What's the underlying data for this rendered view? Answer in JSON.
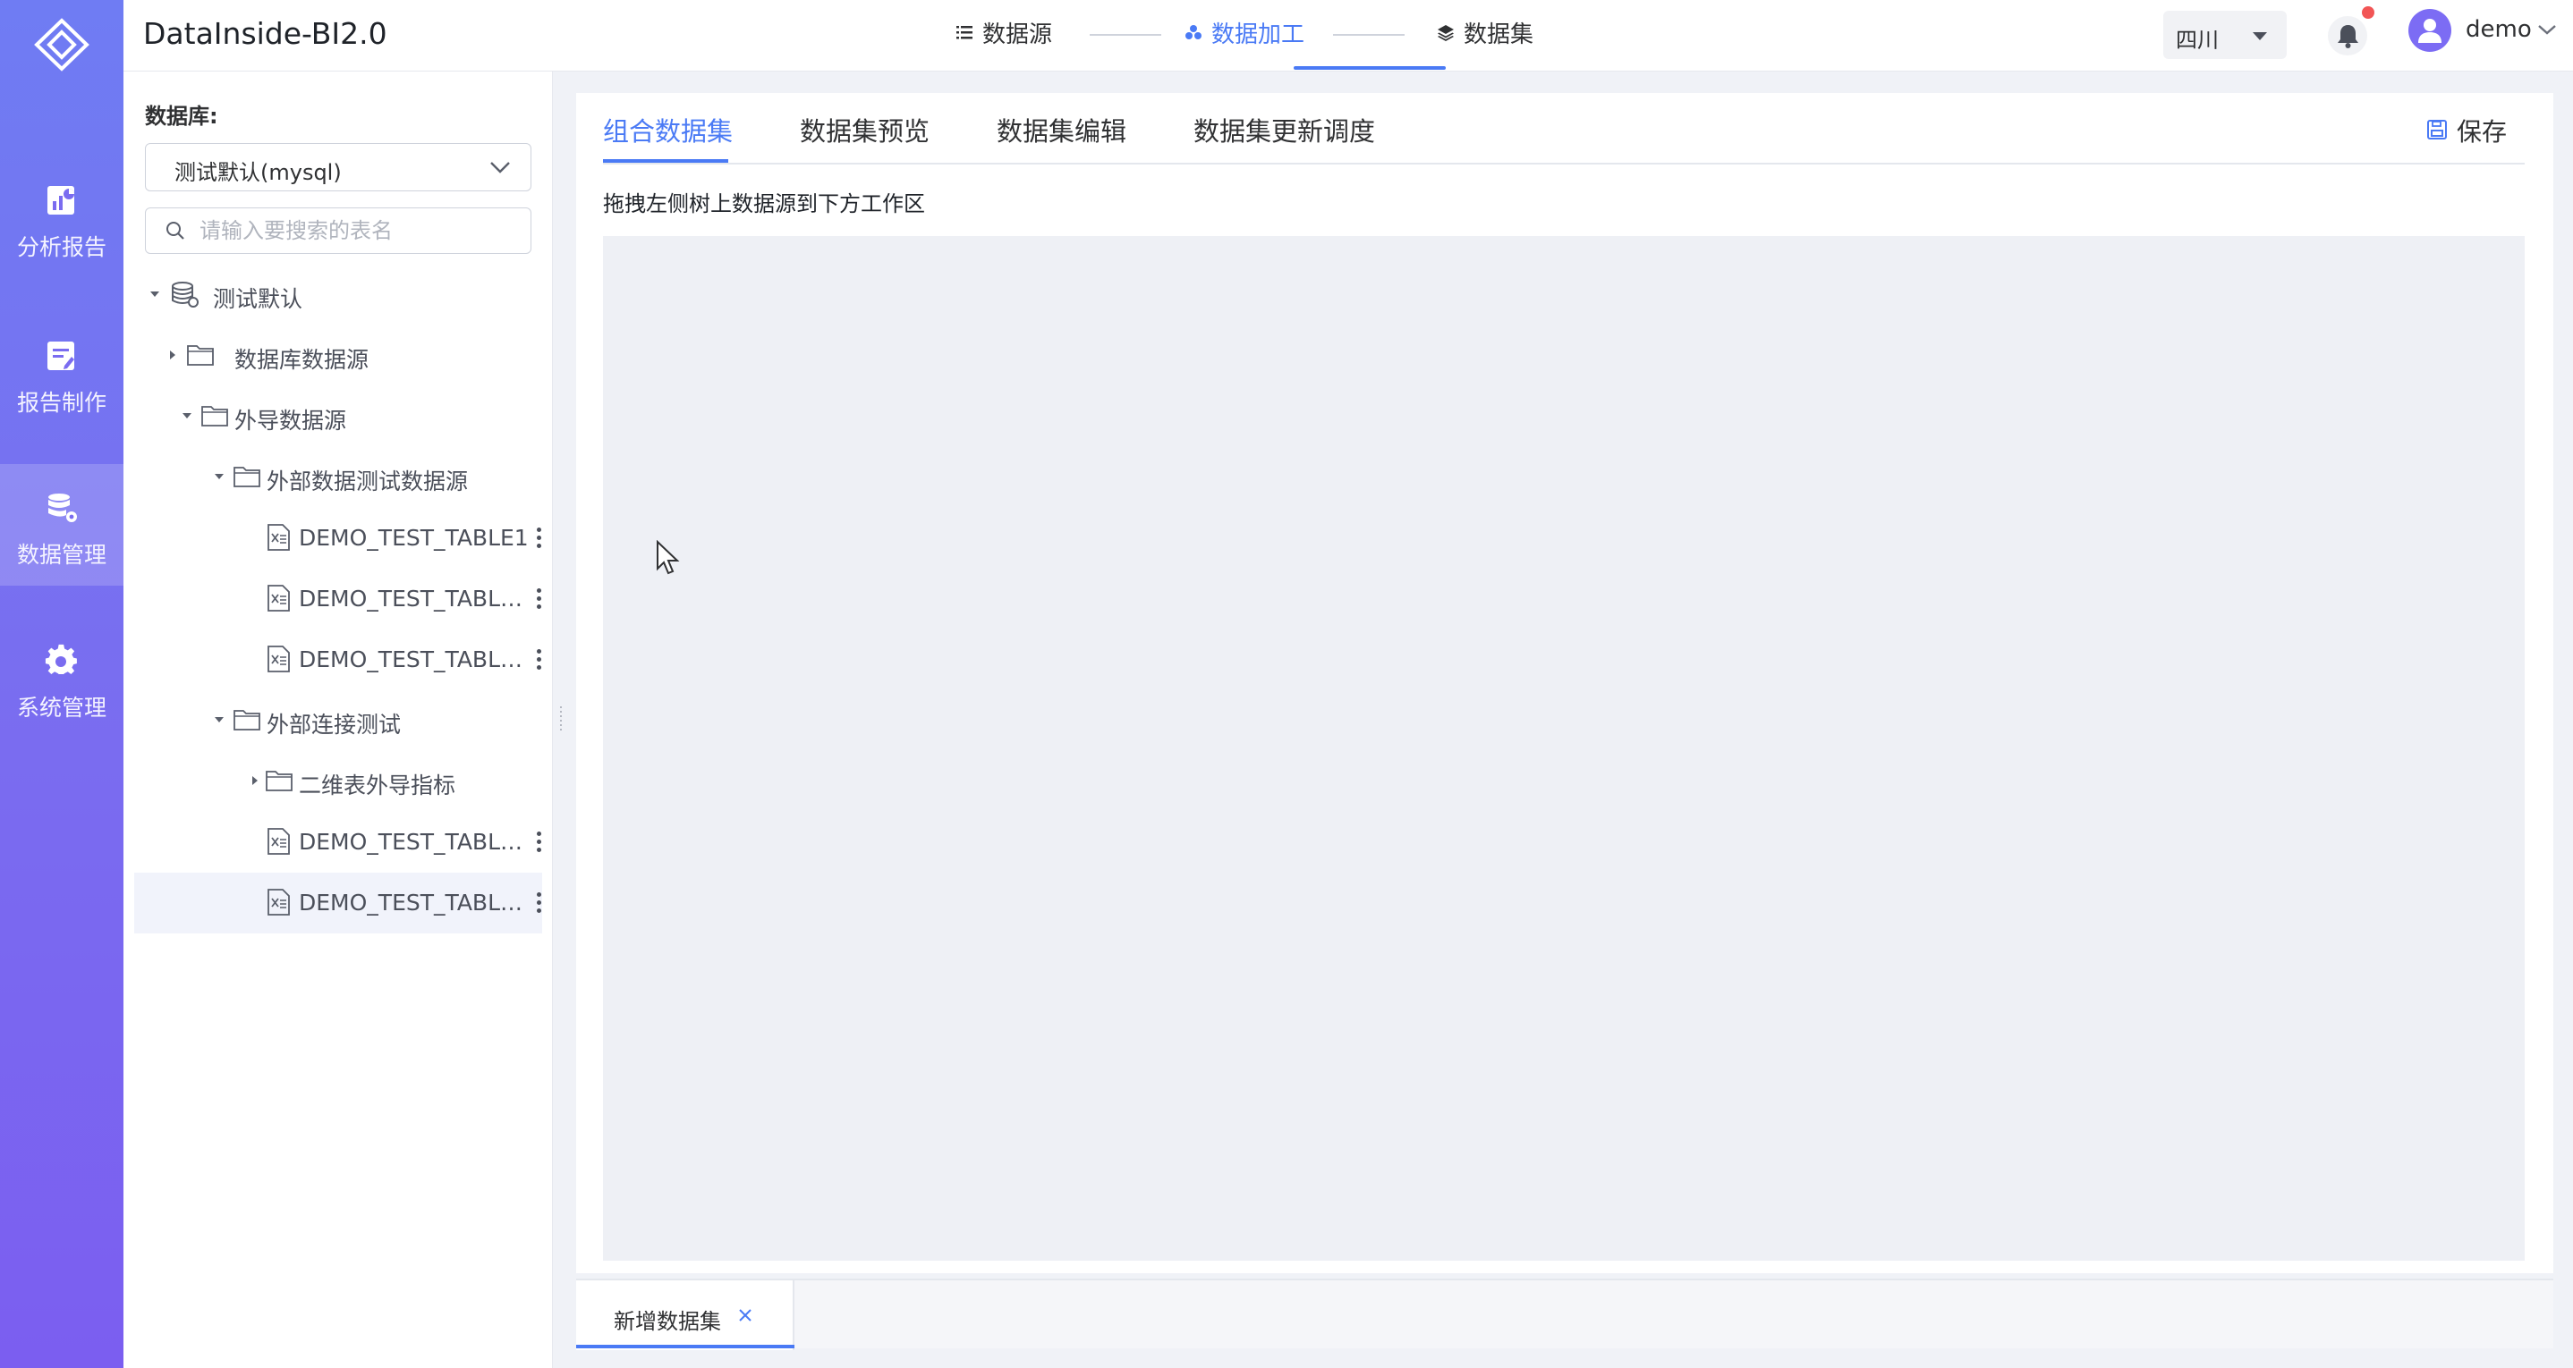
{
  "app": {
    "title": "DataInside-BI2.0"
  },
  "topnav": {
    "steps": [
      {
        "label": "数据源",
        "icon": "list-icon",
        "active": false
      },
      {
        "label": "数据加工",
        "icon": "cluster-icon",
        "active": true
      },
      {
        "label": "数据集",
        "icon": "layers-icon",
        "active": false
      }
    ],
    "region": "四川",
    "user": "demo"
  },
  "rail": {
    "items": [
      {
        "label": "分析报告",
        "icon": "analysis-report-icon",
        "active": false
      },
      {
        "label": "报告制作",
        "icon": "report-edit-icon",
        "active": false
      },
      {
        "label": "数据管理",
        "icon": "database-settings-icon",
        "active": true
      },
      {
        "label": "系统管理",
        "icon": "gear-icon",
        "active": false
      }
    ]
  },
  "leftpanel": {
    "db_label": "数据库:",
    "db_value": "测试默认(mysql)",
    "search_placeholder": "请输入要搜索的表名",
    "tree": [
      {
        "label": "测试默认",
        "type": "database",
        "level": 0,
        "expanded": true
      },
      {
        "label": "数据库数据源",
        "type": "folder",
        "level": 1,
        "expanded": false
      },
      {
        "label": "外导数据源",
        "type": "folder",
        "level": 1,
        "expanded": true
      },
      {
        "label": "外部数据测试数据源",
        "type": "folder",
        "level": 2,
        "expanded": true
      },
      {
        "label": "DEMO_TEST_TABLE1",
        "type": "table",
        "level": 3
      },
      {
        "label": "DEMO_TEST_TABLE_...",
        "type": "table",
        "level": 3
      },
      {
        "label": "DEMO_TEST_TABLE_...",
        "type": "table",
        "level": 3
      },
      {
        "label": "外部连接测试",
        "type": "folder",
        "level": 2,
        "expanded": true
      },
      {
        "label": "二维表外导指标",
        "type": "folder",
        "level": 3,
        "expanded": false
      },
      {
        "label": "DEMO_TEST_TABLE_...",
        "type": "table",
        "level": 3
      },
      {
        "label": "DEMO_TEST_TABLE_...",
        "type": "table",
        "level": 3,
        "selected": true
      }
    ]
  },
  "main": {
    "tabs": [
      "组合数据集",
      "数据集预览",
      "数据集编辑",
      "数据集更新调度"
    ],
    "save_label": "保存",
    "hint": "拖拽左侧树上数据源到下方工作区"
  },
  "bottom_tabs": [
    {
      "label": "新增数据集",
      "closable": true
    }
  ],
  "colors": {
    "accent": "#4a7af5",
    "rail_top": "#6f7cf3",
    "rail_bottom": "#7b5ef0",
    "notification": "#f25555"
  }
}
